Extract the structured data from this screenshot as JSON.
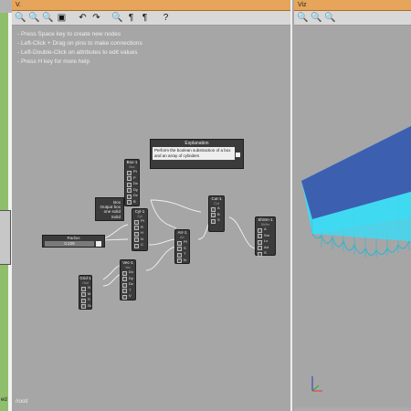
{
  "graph_panel": {
    "title": "V.",
    "toolbar": [
      {
        "icon": "zoom-fit-icon",
        "glyph": "🔍"
      },
      {
        "icon": "zoom-in-icon",
        "glyph": "🔍"
      },
      {
        "icon": "zoom-out-icon",
        "glyph": "🔍"
      },
      {
        "icon": "save-icon",
        "glyph": "▣"
      },
      {
        "icon": "undo-icon",
        "glyph": "↶"
      },
      {
        "icon": "redo-icon",
        "glyph": "↷"
      },
      {
        "icon": "search-icon",
        "glyph": "🔍"
      },
      {
        "icon": "bug-icon",
        "glyph": "¶"
      },
      {
        "icon": "bug-alt-icon",
        "glyph": "¶"
      },
      {
        "icon": "help-icon",
        "glyph": "?"
      }
    ],
    "help_lines": [
      "- Press Space key to create new nodes",
      "- Left-Click + Drag on pins to make connections",
      "- Left-Double-Click on attributes to edit values",
      "- Press H key for more help"
    ],
    "status": "/root/"
  },
  "note": {
    "title": "Explanation",
    "body": "Perform the boolean substraction of a box and an array of cylinders"
  },
  "tooltip": {
    "lines": [
      "Box",
      "Output box",
      "one solid",
      "Solid"
    ]
  },
  "radius_slider": {
    "label": "Radius",
    "value": "0.229"
  },
  "nodes": {
    "box": {
      "title": "Box-1",
      "sub": "Box",
      "pins": [
        "Pt",
        "P",
        "Dx",
        "Dy",
        "Dz",
        "B"
      ]
    },
    "cyl": {
      "title": "Cyl-1",
      "sub": "Cyl",
      "pins": [
        "Pt",
        "R",
        "H",
        "N",
        "C"
      ]
    },
    "grid": {
      "title": "Grid-1",
      "sub": "Grid",
      "pins": [
        "N",
        "M",
        "S",
        "Sr"
      ]
    },
    "vec": {
      "title": "Vec-1",
      "sub": "Vec",
      "pins": [
        "Dx",
        "Dy",
        "Dz",
        "T",
        "V"
      ]
    },
    "arr": {
      "title": "Arr-1",
      "sub": "Arr",
      "pins": [
        "Pt",
        "S",
        "T",
        "N"
      ]
    },
    "cut": {
      "title": "Cut-1",
      "sub": "Cut",
      "pins": [
        "A",
        "B",
        "S"
      ]
    },
    "shape": {
      "title": "ShSm-1",
      "sub": "ShSm",
      "pins": [
        "A",
        "Sm",
        "Lx",
        "Ad",
        "S"
      ]
    }
  },
  "viz_panel": {
    "title": "Viz",
    "toolbar": [
      {
        "icon": "zoom-fit-icon",
        "glyph": "🔍"
      },
      {
        "icon": "zoom-in-icon",
        "glyph": "🔍"
      },
      {
        "icon": "zoom-out-icon",
        "glyph": "🔍"
      }
    ],
    "axis_labels": {
      "x": "x",
      "y": "y",
      "z": "z"
    }
  },
  "left_panel": {
    "partial_label": "ed"
  },
  "colors": {
    "title_bar": "#e7a55b",
    "panel_bg": "#a6a6a6",
    "node_bg": "#3b3b3b",
    "shape_top": "#3d5fb0",
    "shape_side": "#3fd9f2"
  }
}
